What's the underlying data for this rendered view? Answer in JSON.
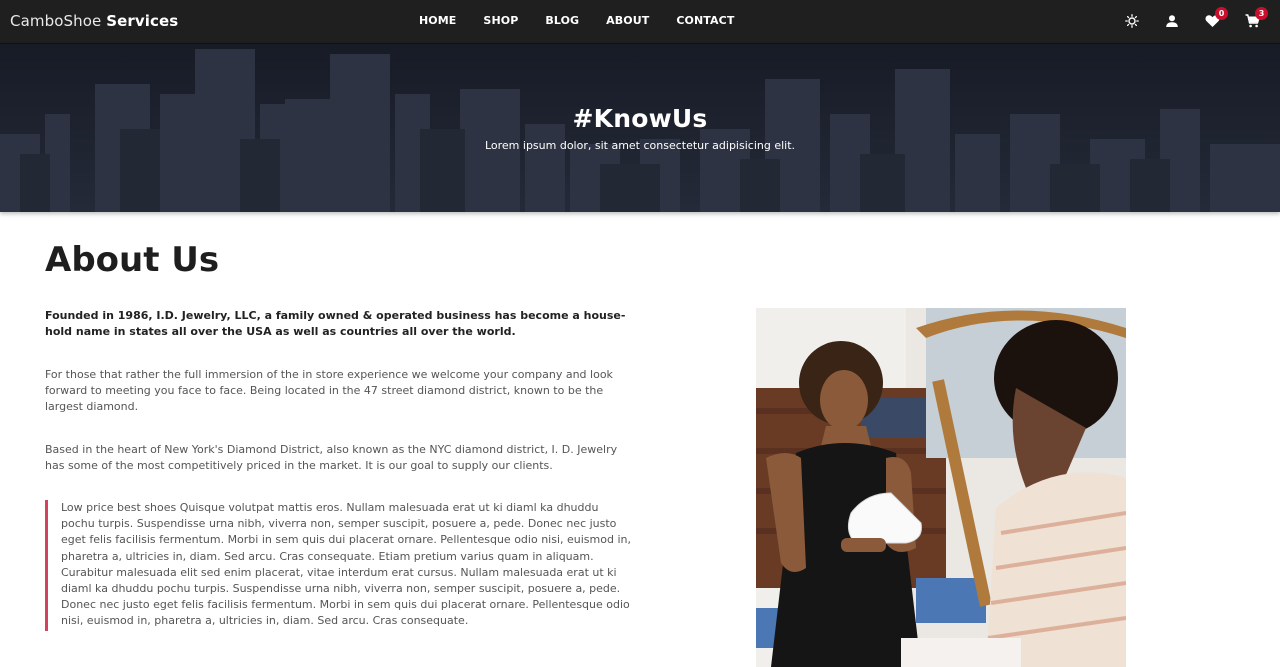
{
  "navbar": {
    "brand_light": "CamboShoe",
    "brand_bold": "Services",
    "links": [
      "HOME",
      "SHOP",
      "BLOG",
      "ABOUT",
      "CONTACT"
    ],
    "icons": [
      "theme-toggle-icon",
      "user-icon",
      "heart-icon",
      "cart-icon"
    ],
    "wishlist_count": "0",
    "cart_count": "3",
    "badge_color": "#c8102e"
  },
  "hero": {
    "title": "#KnowUs",
    "subtitle": "Lorem ipsum dolor, sit amet consectetur adipisicing elit."
  },
  "about": {
    "title": "About Us",
    "intro": "Founded in 1986, I.D. Jewelry, LLC, a family owned & operated business has become a house-hold name in states all over the USA as well as countries all over the world.",
    "paragraph1": "For those that rather the full immersion of the in store experience we welcome your company and look forward to meeting you face to face. Being located in the 47 street diamond district, known to be the largest diamond.",
    "paragraph2": "Based in the heart of New York's Diamond District, also known as the NYC diamond district, I. D. Jewelry has some of the most competitively priced in the market. It is our goal to supply our clients.",
    "quote": "Low price best shoes Quisque volutpat mattis eros. Nullam malesuada erat ut ki diaml ka dhuddu pochu turpis. Suspendisse urna nibh, viverra non, semper suscipit, posuere a, pede. Donec nec justo eget felis facilisis fermentum. Morbi in sem quis dui placerat ornare. Pellentesque odio nisi, euismod in, pharetra a, ultricies in, diam. Sed arcu. Cras consequate. Etiam pretium varius quam in aliquam. Curabitur malesuada elit sed enim placerat, vitae interdum erat cursus. Nullam malesuada erat ut ki diaml ka dhuddu pochu turpis. Suspendisse urna nibh, viverra non, semper suscipit, posuere a, pede. Donec nec justo eget felis facilisis fermentum. Morbi in sem quis dui placerat ornare. Pellentesque odio nisi, euismod in, pharetra a, ultricies in, diam. Sed arcu. Cras consequate.",
    "accent_color": "#d2435d"
  }
}
